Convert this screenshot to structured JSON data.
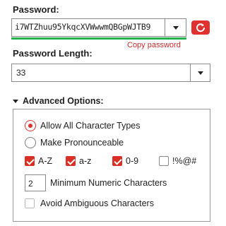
{
  "password": {
    "label": "Password:",
    "value": "i7WTZhuu95YkqcXVWwwmQBGpWJTB9",
    "copy_link": "Copy password",
    "strength_color": "#22b24c",
    "regenerate_icon": "refresh-icon"
  },
  "length": {
    "label": "Password Length:",
    "value": "33"
  },
  "advanced": {
    "toggle_label": "Advanced Options:",
    "options": {
      "all_types_label": "Allow All Character Types",
      "pronounceable_label": "Make Pronounceable",
      "selected": "Allow All Character Types"
    },
    "charsets": [
      {
        "label": "A-Z",
        "checked": true
      },
      {
        "label": "a-z",
        "checked": true
      },
      {
        "label": "0-9",
        "checked": true
      },
      {
        "label": "!%@#",
        "checked": false
      }
    ],
    "min_numeric": {
      "value": "2",
      "label": "Minimum Numeric Characters"
    },
    "avoid_ambiguous": {
      "label": "Avoid Ambiguous Characters",
      "checked": false
    }
  },
  "colors": {
    "accent": "#e03131",
    "text": "#222222"
  }
}
